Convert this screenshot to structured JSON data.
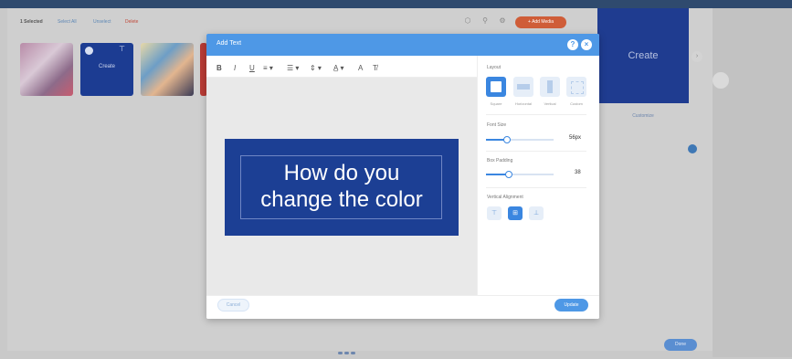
{
  "background": {
    "selection_count": "1 Selected",
    "select_all": "Select All",
    "unselect": "Unselect",
    "delete": "Delete",
    "add_media": "+ Add Media",
    "thumb_create_label": "Create",
    "create_panel_title": "Create",
    "customize_label": "Customize",
    "done_label": "Done"
  },
  "modal": {
    "title": "Add Text",
    "help_icon": "?",
    "close_icon": "×",
    "toolbar": {
      "bold": "B",
      "italic": "I",
      "underline": "U",
      "align": "≡ ▾",
      "list": "☰ ▾",
      "line_height": "⇕ ▾",
      "char_spacing": "A̲ ▾",
      "text_color": "A",
      "clear_format": "T̸"
    },
    "text": {
      "line1": "How do you",
      "line2": "change the color"
    },
    "side": {
      "layout_label": "Layout",
      "layouts": [
        "Square",
        "Horizontal",
        "Vertical",
        "Custom"
      ],
      "font_size_label": "Font Size",
      "font_size_value": "56px",
      "font_size_fraction": 0.3,
      "padding_label": "Box Padding",
      "padding_value": "38",
      "padding_fraction": 0.32,
      "valign_label": "Vertical Alignment"
    },
    "cancel": "Cancel",
    "update": "Update"
  },
  "colors": {
    "accent": "#4e98e6",
    "text_box": "#1c3f94"
  }
}
